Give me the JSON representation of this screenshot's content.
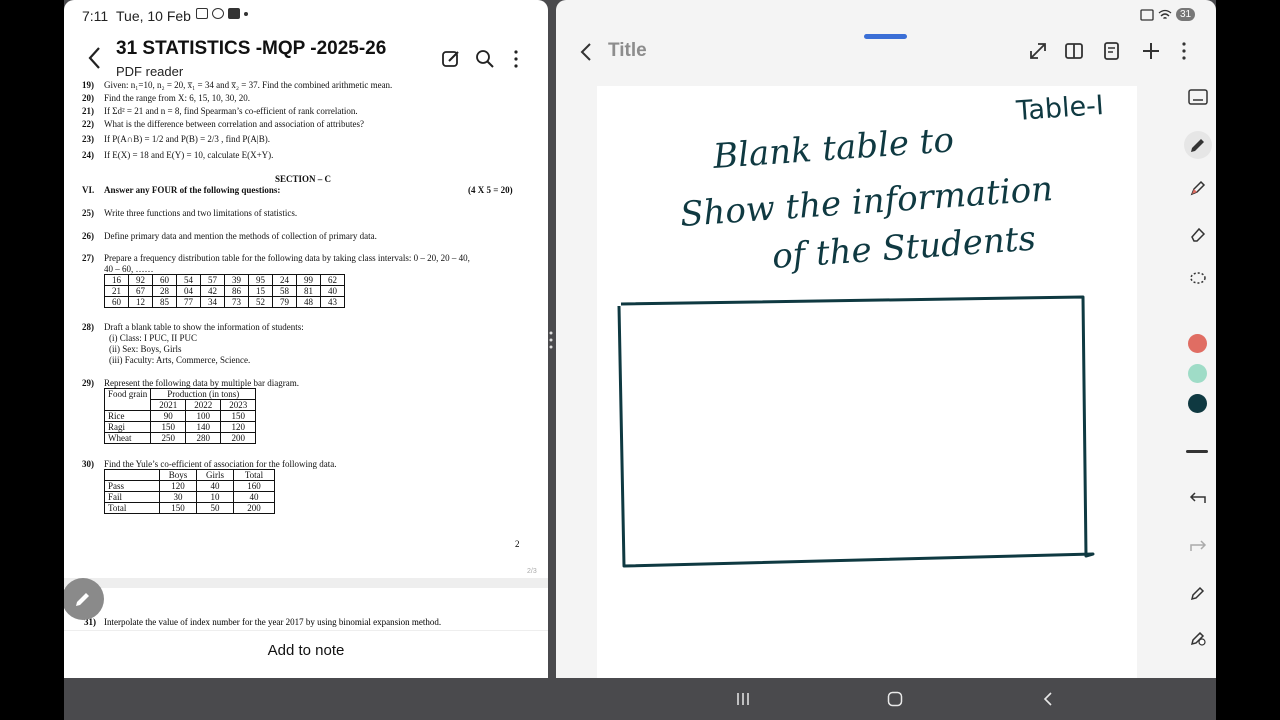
{
  "status": {
    "time": "7:11",
    "date": "Tue, 10 Feb",
    "battery": "31"
  },
  "pdf_app": {
    "title": "31 STATISTICS -MQP -2025-26",
    "subtitle": "PDF reader",
    "add_to_note": "Add to note",
    "page_number": "2",
    "page_indicator": "2/3",
    "questions": [
      {
        "n": "19)",
        "t": "Given: n₁=10, n₂ = 20, x̅₁ = 34 and x̅₂ = 37. Find the combined arithmetic mean."
      },
      {
        "n": "20)",
        "t": "Find the range from X: 6, 15, 10, 30, 20."
      },
      {
        "n": "21)",
        "t": "If Σd² = 21 and n = 8, find Spearman’s co-efficient of rank correlation."
      },
      {
        "n": "22)",
        "t": "What is the difference between correlation and association of attributes?"
      },
      {
        "n": "23)",
        "t": "If P(A∩B) = 1/2 and P(B) = 2/3 , find P(A|B)."
      },
      {
        "n": "24)",
        "t": "If E(X) = 18 and E(Y) = 10, calculate E(X+Y)."
      }
    ],
    "section_title": "SECTION – C",
    "section_roman": "VI.",
    "section_instr": "Answer any FOUR of the following questions:",
    "section_marks": "(4 X 5 = 20)",
    "q25": {
      "n": "25)",
      "t": "Write three functions and two limitations of statistics."
    },
    "q26": {
      "n": "26)",
      "t": "Define primary data and mention the methods of collection of primary data."
    },
    "q27": {
      "n": "27)",
      "t": "Prepare a frequency distribution table for the following data by taking class intervals: 0 – 20, 20 – 40,",
      "t2": "40 – 60, ……"
    },
    "q27_table": [
      [
        "16",
        "92",
        "60",
        "54",
        "57",
        "39",
        "95",
        "24",
        "99",
        "62"
      ],
      [
        "21",
        "67",
        "28",
        "04",
        "42",
        "86",
        "15",
        "58",
        "81",
        "40"
      ],
      [
        "60",
        "12",
        "85",
        "77",
        "34",
        "73",
        "52",
        "79",
        "48",
        "43"
      ]
    ],
    "q28": {
      "n": "28)",
      "t": "Draft a blank table to show the information of students:",
      "i1": "(i)   Class: I PUC, II PUC",
      "i2": "(ii)  Sex: Boys, Girls",
      "i3": "(iii) Faculty: Arts, Commerce, Science."
    },
    "q29": {
      "n": "29)",
      "t": "Represent the following data by multiple bar diagram."
    },
    "q29_table": {
      "h1": "Food grain",
      "h2": "Production (in tons)",
      "years": [
        "2021",
        "2022",
        "2023"
      ],
      "rows": [
        [
          "Rice",
          "90",
          "100",
          "150"
        ],
        [
          "Ragi",
          "150",
          "140",
          "120"
        ],
        [
          "Wheat",
          "250",
          "280",
          "200"
        ]
      ]
    },
    "q30": {
      "n": "30)",
      "t": "Find the Yule’s co-efficient of association for the following data."
    },
    "q30_table": {
      "head": [
        "",
        "Boys",
        "Girls",
        "Total"
      ],
      "rows": [
        [
          "Pass",
          "120",
          "40",
          "160"
        ],
        [
          "Fail",
          "30",
          "10",
          "40"
        ],
        [
          "Total",
          "150",
          "50",
          "200"
        ]
      ]
    },
    "q31": {
      "n": "31)",
      "t": "Interpolate the value of index number for the year 2017 by using binomial expansion method."
    }
  },
  "note_app": {
    "title": "Title",
    "handwriting": {
      "label": "Table-I",
      "line1": "Blank table to",
      "line2": "Show the information",
      "line3": "of the Students"
    },
    "pen_colors": [
      "#e06d63",
      "#9fdcc7",
      "#0f3941"
    ]
  }
}
